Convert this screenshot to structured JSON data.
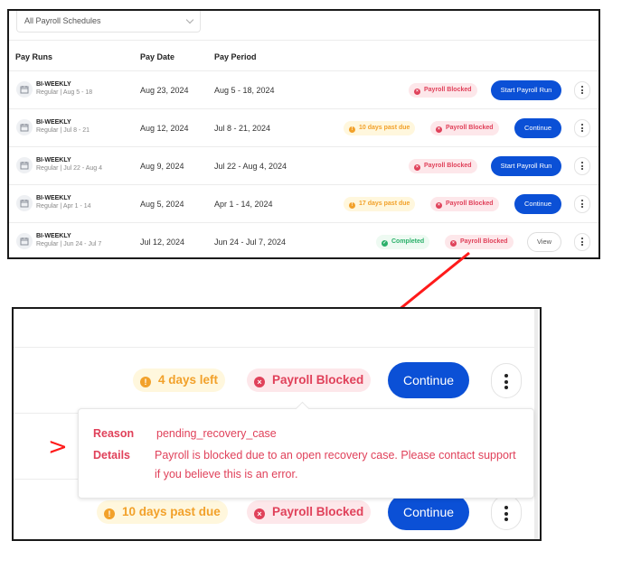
{
  "top_panel": {
    "schedule_select": {
      "value": "All Payroll Schedules"
    },
    "columns": [
      "Pay Runs",
      "Pay Date",
      "Pay Period"
    ],
    "rows": [
      {
        "type": "BI-WEEKLY",
        "subtitle": "Regular | Aug 5 - 18",
        "pay_date": "Aug 23, 2024",
        "pay_period": "Aug 5 - 18, 2024",
        "status_pill": null,
        "blocked_pill": "Payroll Blocked",
        "action": "Start Payroll Run"
      },
      {
        "type": "BI-WEEKLY",
        "subtitle": "Regular | Jul 8 - 21",
        "pay_date": "Aug 12, 2024",
        "pay_period": "Jul 8 - 21, 2024",
        "status_pill": "10 days past due",
        "blocked_pill": "Payroll Blocked",
        "action": "Continue"
      },
      {
        "type": "BI-WEEKLY",
        "subtitle": "Regular | Jul 22 - Aug 4",
        "pay_date": "Aug 9, 2024",
        "pay_period": "Jul 22 - Aug 4, 2024",
        "status_pill": null,
        "blocked_pill": "Payroll Blocked",
        "action": "Start Payroll Run"
      },
      {
        "type": "BI-WEEKLY",
        "subtitle": "Regular | Apr 1 - 14",
        "pay_date": "Aug 5, 2024",
        "pay_period": "Apr 1 - 14, 2024",
        "status_pill": "17 days past due",
        "blocked_pill": "Payroll Blocked",
        "action": "Continue"
      },
      {
        "type": "BI-WEEKLY",
        "subtitle": "Regular | Jun 24 - Jul 7",
        "pay_date": "Jul 12, 2024",
        "pay_period": "Jun 24 - Jul 7, 2024",
        "status_pill": "Completed",
        "blocked_pill": "Payroll Blocked",
        "action": "View"
      }
    ]
  },
  "bottom_panel": {
    "row1": {
      "status_pill": "4 days left",
      "blocked_pill": "Payroll Blocked",
      "action": "Continue"
    },
    "tooltip": {
      "reason_label": "Reason",
      "reason_value": "pending_recovery_case",
      "details_label": "Details",
      "details_value": "Payroll is blocked due to an open recovery case. Please contact support if you believe this is an error."
    },
    "row2": {
      "status_pill": "10 days past due",
      "blocked_pill": "Payroll Blocked",
      "action": "Continue"
    },
    "annotation_marker": ">"
  },
  "colors": {
    "primary_button": "#0b50d6",
    "blocked_red": "#e0415a",
    "warning_orange": "#f2a12a",
    "success_green": "#2bb06a",
    "annotation_red": "#ff1a1a"
  }
}
